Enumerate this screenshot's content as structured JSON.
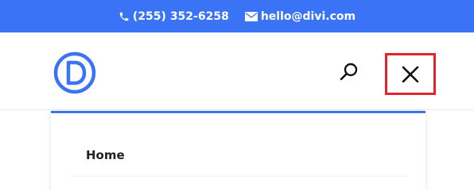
{
  "topbar": {
    "phone": "(255) 352-6258",
    "email": "hello@divi.com",
    "bg_color": "#3b73f7"
  },
  "header": {
    "logo_icon": "divi-logo-icon",
    "search_icon": "search-icon",
    "close_icon": "close-icon",
    "highlight_color": "#e0242a"
  },
  "menu": {
    "items": [
      {
        "label": "Home"
      }
    ]
  }
}
